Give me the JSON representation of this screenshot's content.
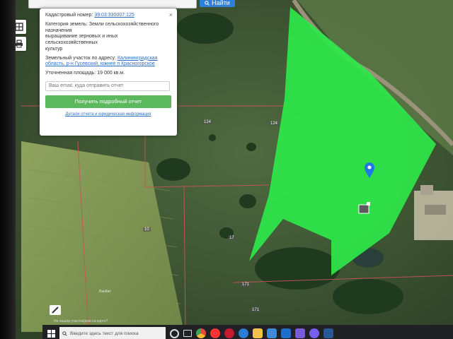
{
  "search": {
    "button_label": "Найти"
  },
  "panel": {
    "cadastral_label": "Кадастровый номер:",
    "cadastral_value": "39:03:330007:125",
    "category_label": "Категория земель:",
    "category_value_lines": [
      "Земли сельскохозяйственного",
      "назначения",
      "выращивание зерновых и иных сельскохозяйственных",
      "культур"
    ],
    "address_label": "Земельный участок по адресу:",
    "address_value_lines": [
      "Калининградская",
      "область, р-н Гусевский, южнее п Красногорское"
    ],
    "area_label": "Уточненная площадь:",
    "area_value": "19 000 кв.м.",
    "email_placeholder": "Ваш email, куда отправить отчет",
    "report_button_label": "Получить подробный отчет",
    "details_link_label": "Детали отчета и юридическая информация",
    "close_label": "×"
  },
  "map": {
    "parcel_color": "#2ee84a",
    "parcel_labels": [
      "124",
      "124",
      "10",
      "17",
      "171",
      "171"
    ],
    "field_label": "Ранбит"
  },
  "bottom": {
    "map_question": "Не нашли участок/дом на карте?"
  },
  "taskbar": {
    "search_placeholder": "Введите здесь текст для поиска",
    "app_icons": [
      "cortana-icon",
      "task-view-icon",
      "chrome-icon",
      "yandex-icon",
      "opera-icon",
      "edge-icon",
      "explorer-icon",
      "store-icon",
      "mail-icon",
      "photos-icon",
      "viber-icon",
      "word-icon"
    ]
  }
}
